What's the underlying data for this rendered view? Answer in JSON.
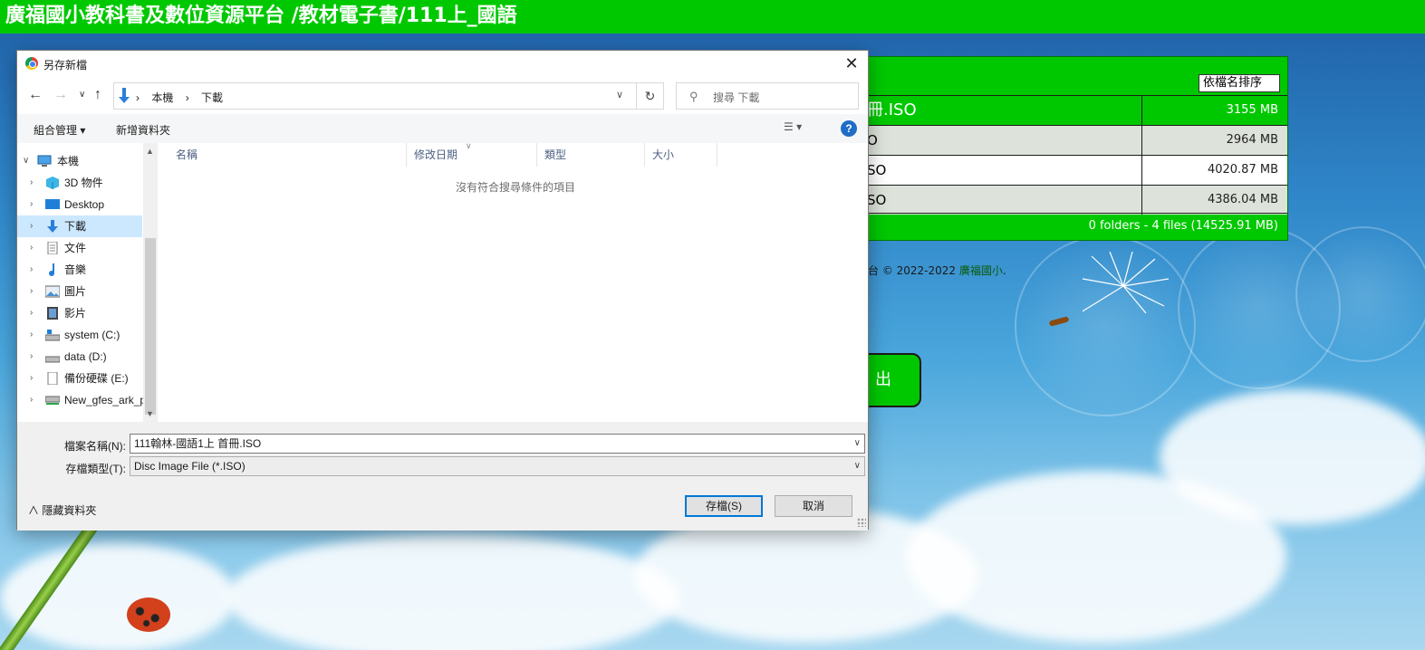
{
  "page": {
    "title": "廣福國小教科書及數位資源平台 /教材電子書/111上_國語"
  },
  "background_panel": {
    "sort_select": "依檔名排序",
    "files": [
      {
        "name": "冊.ISO",
        "size": "3155 MB"
      },
      {
        "name": "O",
        "size": "2964 MB"
      },
      {
        "name": "SO",
        "size": "4020.87 MB"
      },
      {
        "name": "SO",
        "size": "4386.04 MB"
      }
    ],
    "summary": "0 folders - 4 files (14525.91 MB)",
    "copyright_prefix": "台 © 2022-2022",
    "copyright_link": "廣福國小",
    "exit_label": "出"
  },
  "dialog": {
    "title": "另存新檔",
    "close_label": "✕",
    "address": {
      "crumbs": [
        "本機",
        "下載"
      ],
      "refresh": "↻"
    },
    "search_placeholder": "搜尋 下載",
    "toolbar": {
      "organize": "組合管理",
      "new_folder": "新增資料夾",
      "help": "?"
    },
    "sidebar": [
      {
        "label": "本機",
        "icon": "computer-icon"
      },
      {
        "label": "3D 物件",
        "icon": "3d-objects-icon"
      },
      {
        "label": "Desktop",
        "icon": "desktop-icon"
      },
      {
        "label": "下載",
        "icon": "download-icon",
        "selected": true
      },
      {
        "label": "文件",
        "icon": "document-icon"
      },
      {
        "label": "音樂",
        "icon": "music-icon"
      },
      {
        "label": "圖片",
        "icon": "pictures-icon"
      },
      {
        "label": "影片",
        "icon": "video-icon"
      },
      {
        "label": "system (C:)",
        "icon": "drive-icon"
      },
      {
        "label": "data (D:)",
        "icon": "drive-icon"
      },
      {
        "label": "備份硬碟 (E:)",
        "icon": "drive-icon"
      },
      {
        "label": "New_gfes_ark_p",
        "icon": "network-drive-icon"
      }
    ],
    "columns": [
      "名稱",
      "修改日期",
      "類型",
      "大小"
    ],
    "empty_message": "沒有符合搜尋條件的項目",
    "filename_label": "檔案名稱(N):",
    "filename_value": "111翰林-國語1上 首冊.ISO",
    "filetype_label": "存檔類型(T):",
    "filetype_value": "Disc Image File (*.ISO)",
    "hide_folders": "隱藏資料夾",
    "save_button": "存檔(S)",
    "cancel_button": "取消"
  },
  "colors": {
    "brand_green": "#00c800",
    "selection": "#cce8ff",
    "primary_border": "#0078d7"
  }
}
